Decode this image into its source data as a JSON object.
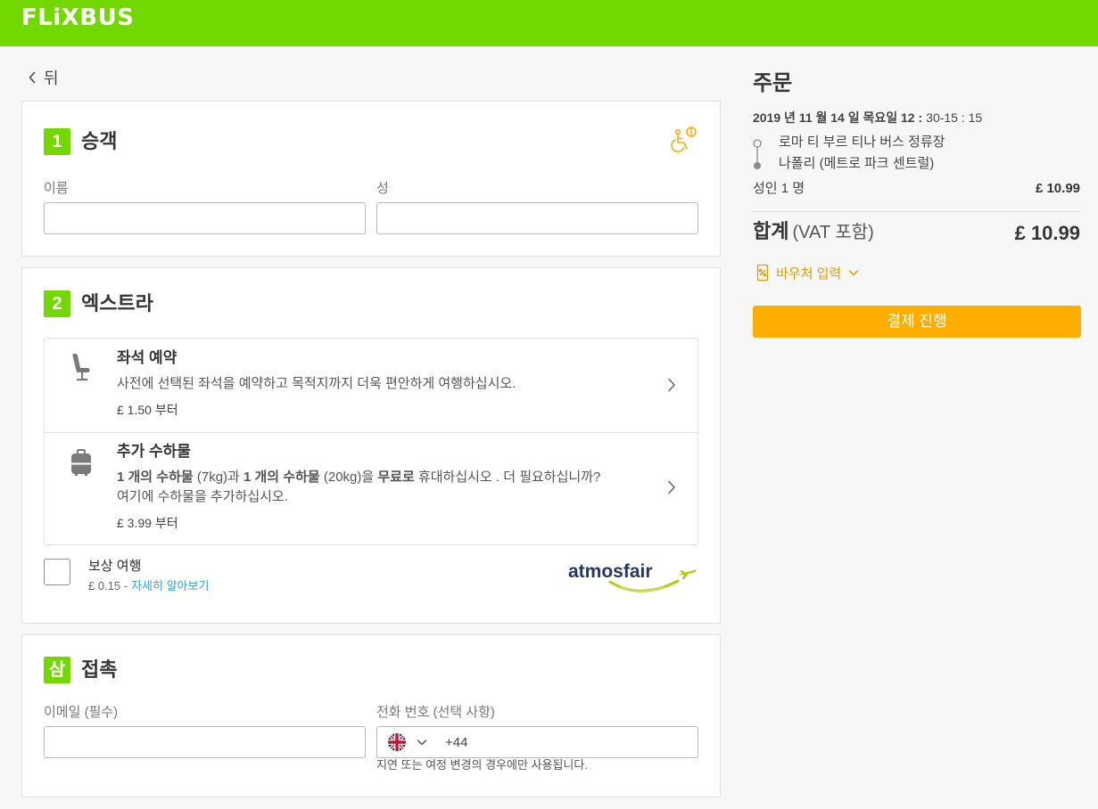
{
  "colors": {
    "brand_green": "#73d700",
    "accent_orange": "#ffad00",
    "link_blue": "#2fa4d6",
    "text_dark": "#353535"
  },
  "header": {
    "logo": "FLiXBUS"
  },
  "back_link": {
    "label": "뒤",
    "icon": "chevron-left-icon"
  },
  "passengers": {
    "step": "1",
    "title": "승객",
    "accessibility_icon": "wheelchair-info-icon",
    "first_name_label": "이름",
    "last_name_label": "성"
  },
  "extras": {
    "step": "2",
    "title": "엑스트라",
    "items": [
      {
        "icon": "seat-icon",
        "title": "좌석 예약",
        "description": "사전에 선택된 좌석을 예약하고 목적지까지 더욱 편안하게 여행하십시오.",
        "price": "£ 1.50 부터"
      },
      {
        "icon": "luggage-icon",
        "title": "추가 수하물",
        "description_parts": [
          "1 개의 수하물",
          " (7kg)과 ",
          "1 개의 수하물",
          " (20kg)을 ",
          "무료로",
          " 휴대하십시오 . 더 필요하십니까?",
          "여기에 수하물을 추가하십시오."
        ],
        "price": "£ 3.99 부터"
      }
    ],
    "compensation": {
      "checked": false,
      "title": "보상 여행",
      "price": "£ 0.15 -",
      "link": "자세히 알아보기",
      "partner_logo": "atmosfair"
    }
  },
  "contact": {
    "step": "삼",
    "title": "접촉",
    "email_label": "이메일 (필수)",
    "phone_label": "전화 번호 (선택 사항)",
    "phone_country_icon": "uk-flag-icon",
    "phone_prefix": "+44",
    "phone_hint": "지연 또는 여정 변경의 경우에만 사용됩니다."
  },
  "order": {
    "title": "주문",
    "date_bold": "2019 년 11 월 14 일 목요일 12 :",
    "time": "30-15 : 15",
    "from": "로마 티 부르 티나 버스 정류장",
    "to": "나폴리 (메트로 파크 센트럴)",
    "passenger_label": "성인 1 명",
    "passenger_price": "£ 10.99",
    "total_label": "합계",
    "total_note": "(VAT 포함)",
    "total_price": "£ 10.99",
    "voucher_label": "바우처 입력",
    "checkout_button": "결제 진행"
  }
}
